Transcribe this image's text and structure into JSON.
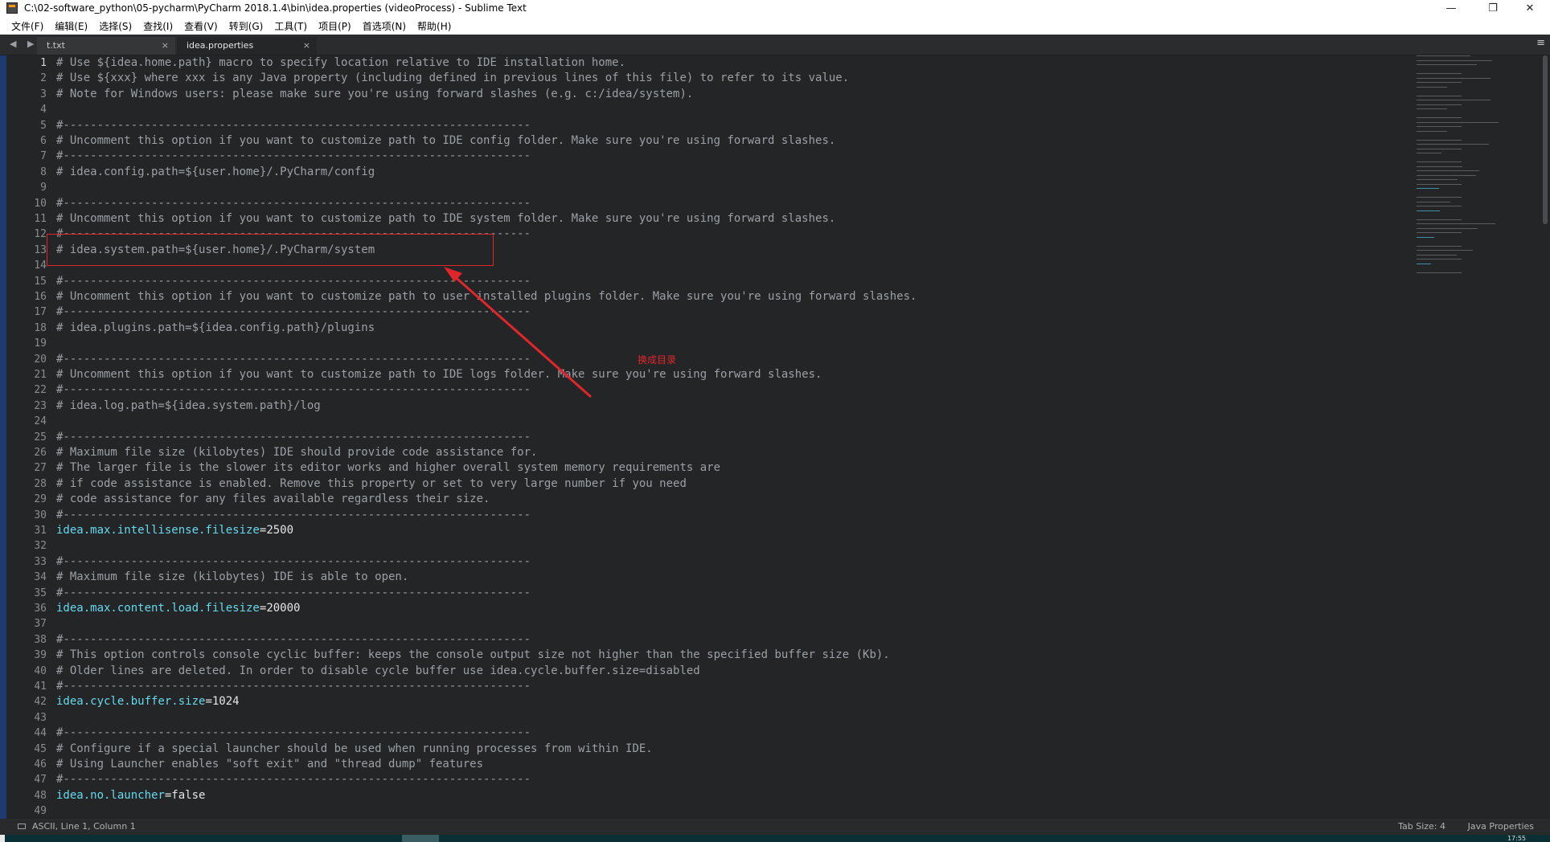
{
  "window": {
    "title": "C:\\02-software_python\\05-pycharm\\PyCharm 2018.1.4\\bin\\idea.properties (videoProcess) - Sublime Text",
    "minimize": "—",
    "maximize": "❐",
    "close": "✕"
  },
  "menu": [
    "文件(F)",
    "编辑(E)",
    "选择(S)",
    "查找(I)",
    "查看(V)",
    "转到(G)",
    "工具(T)",
    "项目(P)",
    "首选项(N)",
    "帮助(H)"
  ],
  "tabs": [
    {
      "label": "t.txt",
      "close": "×",
      "active": false
    },
    {
      "label": "idea.properties",
      "close": "×",
      "active": true
    }
  ],
  "nav_arrows": "◀ ▶",
  "tab_menu_icon": "≡",
  "current_line": 1,
  "lines": [
    "# Use ${idea.home.path} macro to specify location relative to IDE installation home.",
    "# Use ${xxx} where xxx is any Java property (including defined in previous lines of this file) to refer to its value.",
    "# Note for Windows users: please make sure you're using forward slashes (e.g. c:/idea/system).",
    "",
    "#---------------------------------------------------------------------",
    "# Uncomment this option if you want to customize path to IDE config folder. Make sure you're using forward slashes.",
    "#---------------------------------------------------------------------",
    "# idea.config.path=${user.home}/.PyCharm/config",
    "",
    "#---------------------------------------------------------------------",
    "# Uncomment this option if you want to customize path to IDE system folder. Make sure you're using forward slashes.",
    "#---------------------------------------------------------------------",
    "# idea.system.path=${user.home}/.PyCharm/system",
    "",
    "#---------------------------------------------------------------------",
    "# Uncomment this option if you want to customize path to user installed plugins folder. Make sure you're using forward slashes.",
    "#---------------------------------------------------------------------",
    "# idea.plugins.path=${idea.config.path}/plugins",
    "",
    "#---------------------------------------------------------------------",
    "# Uncomment this option if you want to customize path to IDE logs folder. Make sure you're using forward slashes.",
    "#---------------------------------------------------------------------",
    "# idea.log.path=${idea.system.path}/log",
    "",
    "#---------------------------------------------------------------------",
    "# Maximum file size (kilobytes) IDE should provide code assistance for.",
    "# The larger file is the slower its editor works and higher overall system memory requirements are",
    "# if code assistance is enabled. Remove this property or set to very large number if you need",
    "# code assistance for any files available regardless their size.",
    "#---------------------------------------------------------------------",
    "idea.max.intellisense.filesize=2500",
    "",
    "#---------------------------------------------------------------------",
    "# Maximum file size (kilobytes) IDE is able to open.",
    "#---------------------------------------------------------------------",
    "idea.max.content.load.filesize=20000",
    "",
    "#---------------------------------------------------------------------",
    "# This option controls console cyclic buffer: keeps the console output size not higher than the specified buffer size (Kb).",
    "# Older lines are deleted. In order to disable cycle buffer use idea.cycle.buffer.size=disabled",
    "#---------------------------------------------------------------------",
    "idea.cycle.buffer.size=1024",
    "",
    "#---------------------------------------------------------------------",
    "# Configure if a special launcher should be used when running processes from within IDE.",
    "# Using Launcher enables \"soft exit\" and \"thread dump\" features",
    "#---------------------------------------------------------------------",
    "idea.no.launcher=false",
    "",
    "#---------------------------------------------------------------------"
  ],
  "annotation": {
    "text": "换成目录",
    "color": "#e0262b"
  },
  "status": {
    "left": "ASCII, Line 1, Column 1",
    "tab_size": "Tab Size: 4",
    "syntax": "Java Properties"
  },
  "taskbar": {
    "clock": "17:55"
  },
  "colors": {
    "editor_bg": "#242526",
    "comment": "#9aa0a6",
    "key": "#66d9ef",
    "annotation_red": "#e0262b"
  }
}
